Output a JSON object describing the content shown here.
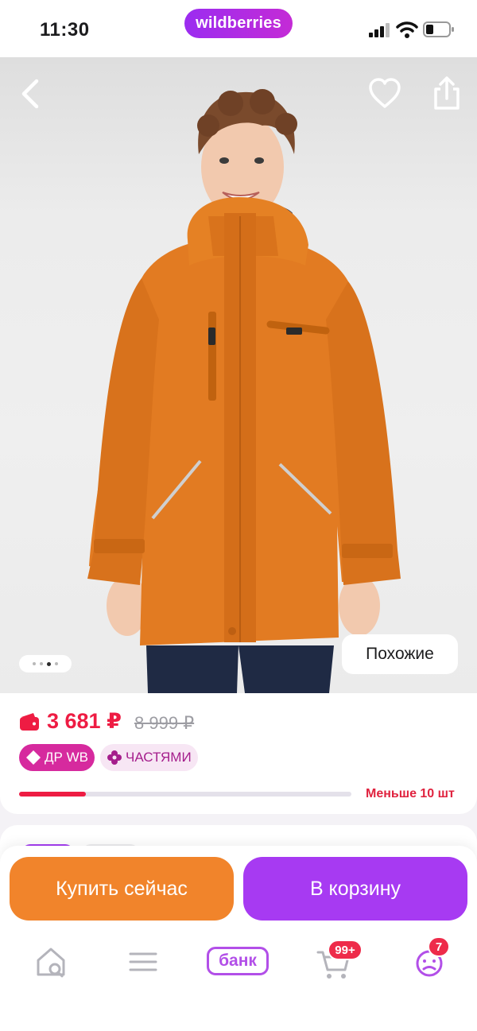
{
  "status_bar": {
    "time": "11:30",
    "brand": "wildberries"
  },
  "product_image": {
    "similar_label": "Похожие",
    "gallery_dots": 4,
    "gallery_active_index": 2
  },
  "price_card": {
    "price": "3 681 ₽",
    "old_price": "8 999 ₽",
    "badges": [
      {
        "label": "ДР WB",
        "icon": "tag-icon"
      },
      {
        "label": "ЧАСТЯМИ",
        "icon": "petals-icon"
      }
    ],
    "stock_text": "Меньше 10 шт",
    "stock_fill_fraction": 0.2,
    "price_color": "#ee1c43"
  },
  "actions": {
    "buy_now": "Купить сейчас",
    "add_to_cart": "В корзину",
    "buy_now_color": "#f1842b",
    "add_to_cart_color": "#a73af2"
  },
  "tab_bar": {
    "items": [
      {
        "icon": "home-search-icon"
      },
      {
        "icon": "menu-icon"
      },
      {
        "label": "банк"
      },
      {
        "icon": "cart-icon",
        "badge": "99+"
      },
      {
        "icon": "profile-icon",
        "badge": "7"
      }
    ]
  }
}
